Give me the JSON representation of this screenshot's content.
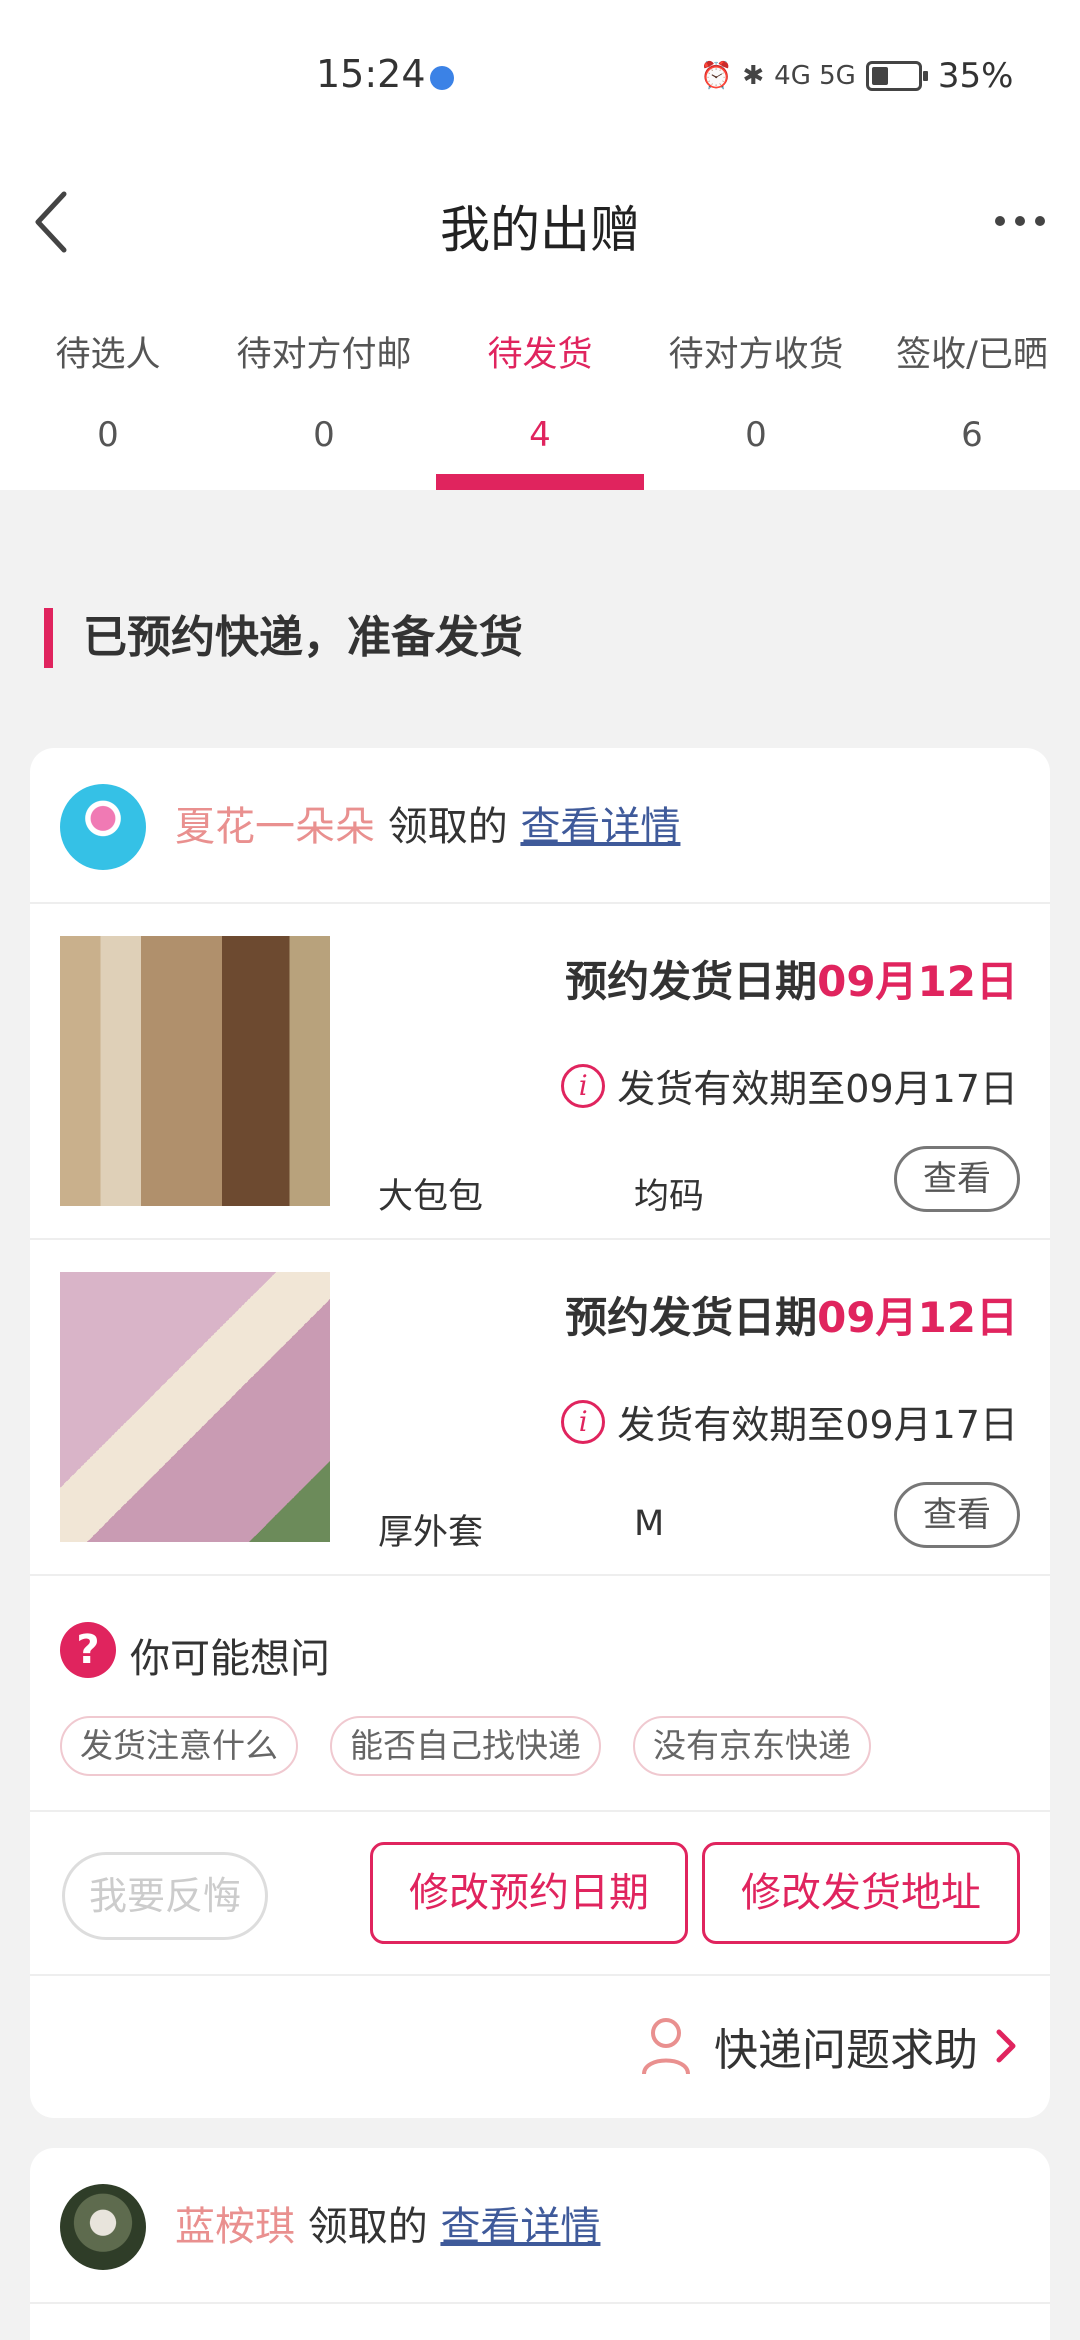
{
  "status_bar": {
    "time": "15:24",
    "network": "4G 5G",
    "battery": "35%"
  },
  "nav": {
    "title": "我的出赠"
  },
  "tabs": [
    {
      "label": "待选人",
      "count": "0"
    },
    {
      "label": "待对方付邮",
      "count": "0"
    },
    {
      "label": "待发货",
      "count": "4"
    },
    {
      "label": "待对方收货",
      "count": "0"
    },
    {
      "label": "签收/已晒",
      "count": "6"
    }
  ],
  "active_tab": "待发货",
  "section_title": "已预约快递，准备发货",
  "orders": [
    {
      "receiver": "夏花一朵朵",
      "received_text": "领取的",
      "detail_link": "查看详情",
      "items": [
        {
          "schedule_label": "预约发货日期",
          "schedule_date": "09月12日",
          "validity": "发货有效期至09月17日",
          "name": "大包包",
          "size": "均码",
          "view": "查看"
        },
        {
          "schedule_label": "预约发货日期",
          "schedule_date": "09月12日",
          "validity": "发货有效期至09月17日",
          "name": "厚外套",
          "size": "M",
          "view": "查看"
        }
      ],
      "faq": {
        "icon": "?",
        "title": "你可能想问",
        "chips": [
          "发货注意什么",
          "能否自己找快递",
          "没有京东快递"
        ]
      },
      "actions": {
        "regret": "我要反悔",
        "edit_date": "修改预约日期",
        "edit_address": "修改发货地址"
      },
      "help": "快递问题求助"
    },
    {
      "receiver": "蓝桉琪",
      "received_text": "领取的",
      "detail_link": "查看详情"
    }
  ],
  "colors": {
    "accent": "#e0245e",
    "giver_name": "#e9908f",
    "link": "#3f5a9a"
  },
  "icons": [
    "back-arrow-icon",
    "more-icon",
    "info-icon",
    "question-icon",
    "person-icon",
    "chevron-right-icon"
  ]
}
